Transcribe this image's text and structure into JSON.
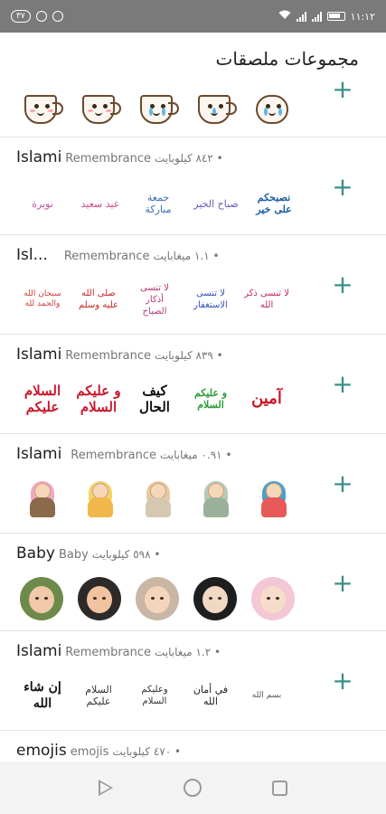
{
  "status_bar": {
    "left_pill": "٣٧",
    "time": "١١:١٢"
  },
  "header": {
    "title": "مجموعات ملصقات"
  },
  "packs": [
    {
      "name": "",
      "author": "",
      "meta": ""
    },
    {
      "name": "Islami",
      "author": "Remembrance",
      "meta": "• ٨٤٢ كيلوبايت",
      "stickers": [
        {
          "text": "نويرة"
        },
        {
          "text": "عيد سعيد"
        },
        {
          "text": "جمعة مباركة"
        },
        {
          "text": "صباح الخير"
        },
        {
          "text": "نصبحكم على خير"
        }
      ]
    },
    {
      "name": "Isl...",
      "author": "Remembrance",
      "meta": "• ١.١ ميغابايت",
      "stickers": [
        {
          "text": "سبحان الله والحمد لله"
        },
        {
          "text": "صلى الله عليه وسلم"
        },
        {
          "text": "لا تنسى أذكار الصباح"
        },
        {
          "text": "لا تنسى الاستغفار"
        },
        {
          "text": "لا تنسى ذكر الله"
        }
      ]
    },
    {
      "name": "Islami",
      "author": "Remembrance",
      "meta": "• ٨٣٩ كيلوبايت",
      "stickers": [
        {
          "text": "السلام عليكم"
        },
        {
          "text": "و عليكم السلام"
        },
        {
          "text": "كيف الحال"
        },
        {
          "text": "و عليكم السلام"
        },
        {
          "text": "آمين"
        }
      ]
    },
    {
      "name": "Islami",
      "author": "Remembrance",
      "meta": "• ٠.٩١ ميغابايت"
    },
    {
      "name": "Baby",
      "author": "Baby",
      "meta": "• ٥٩٨ كيلوبايت"
    },
    {
      "name": "Islami",
      "author": "Remembrance",
      "meta": "• ١.٢ ميغابايت",
      "stickers": [
        {
          "text": "إن شاء الله"
        },
        {
          "text": "السلام عليكم"
        },
        {
          "text": "وعليكم السلام"
        },
        {
          "text": "في أمان الله"
        },
        {
          "text": "بسم الله"
        }
      ]
    },
    {
      "name": "emojis",
      "author": "emojis",
      "meta": "• ٤٧٠ كيلوبايت"
    }
  ],
  "add_label": "+",
  "colors": {
    "accent": "#3a8f86",
    "status_bar": "#7a7a7a",
    "divider": "#e2e2e2"
  }
}
